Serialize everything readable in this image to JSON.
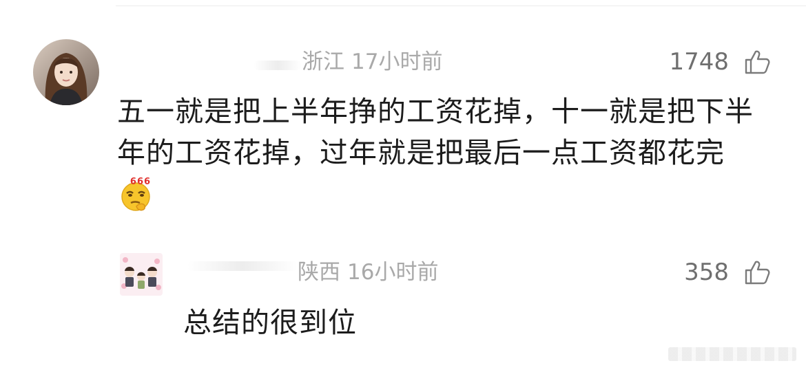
{
  "comments": [
    {
      "location": "浙江",
      "time": "17小时前",
      "likes": "1748",
      "text": "五一就是把上半年挣的工资花掉，十一就是把下半年的工资花掉，过年就是把最后一点工资都花完",
      "emoji_text": "666",
      "emoji_icon": "thinking-666-emoji"
    },
    {
      "location": "陕西",
      "time": "16小时前",
      "likes": "358",
      "text": "总结的很到位"
    }
  ],
  "icons": {
    "like": "thumbs-up-icon"
  },
  "colors": {
    "meta": "#a9a9a9",
    "like_count": "#6f6f6f",
    "text": "#1c1c1c",
    "emoji_face": "#f7c52c",
    "emoji_666": "#e0302c"
  }
}
